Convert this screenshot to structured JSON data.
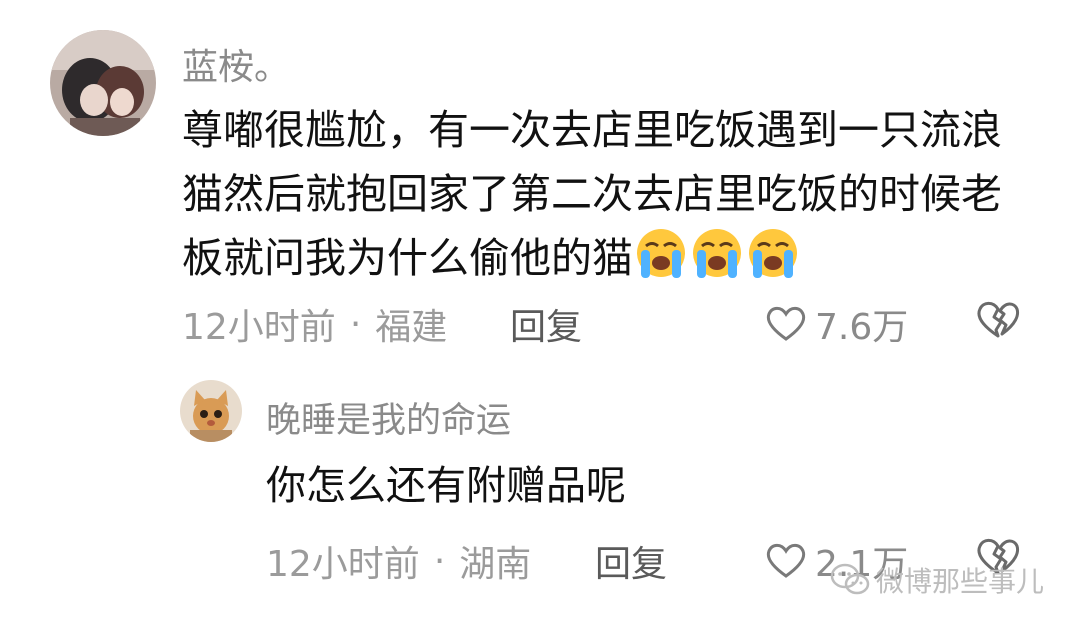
{
  "comments": [
    {
      "username": "蓝桉。",
      "text": "尊嘟很尴尬，有一次去店里吃饭遇到一只流浪猫然后就抱回家了第二次去店里吃饭的时候老板就问我为什么偷他的猫",
      "emoji": "loudly-crying-face",
      "emoji_count": 3,
      "time": "12小时前",
      "location": "福建",
      "reply_label": "回复",
      "likes": "7.6万",
      "avatar_icon": "avatar-anime-couple-icon"
    },
    {
      "username": "晚睡是我的命运",
      "text": "你怎么还有附赠品呢",
      "time": "12小时前",
      "location": "湖南",
      "reply_label": "回复",
      "likes": "2.1万",
      "avatar_icon": "avatar-cat-icon"
    }
  ],
  "separator": "·",
  "watermark": {
    "text": "微博那些事儿",
    "icon": "wechat-icon"
  },
  "colors": {
    "username": "#8a8a8a",
    "text": "#111111",
    "meta": "#9b9b9b",
    "reply": "#5a5a5a"
  }
}
